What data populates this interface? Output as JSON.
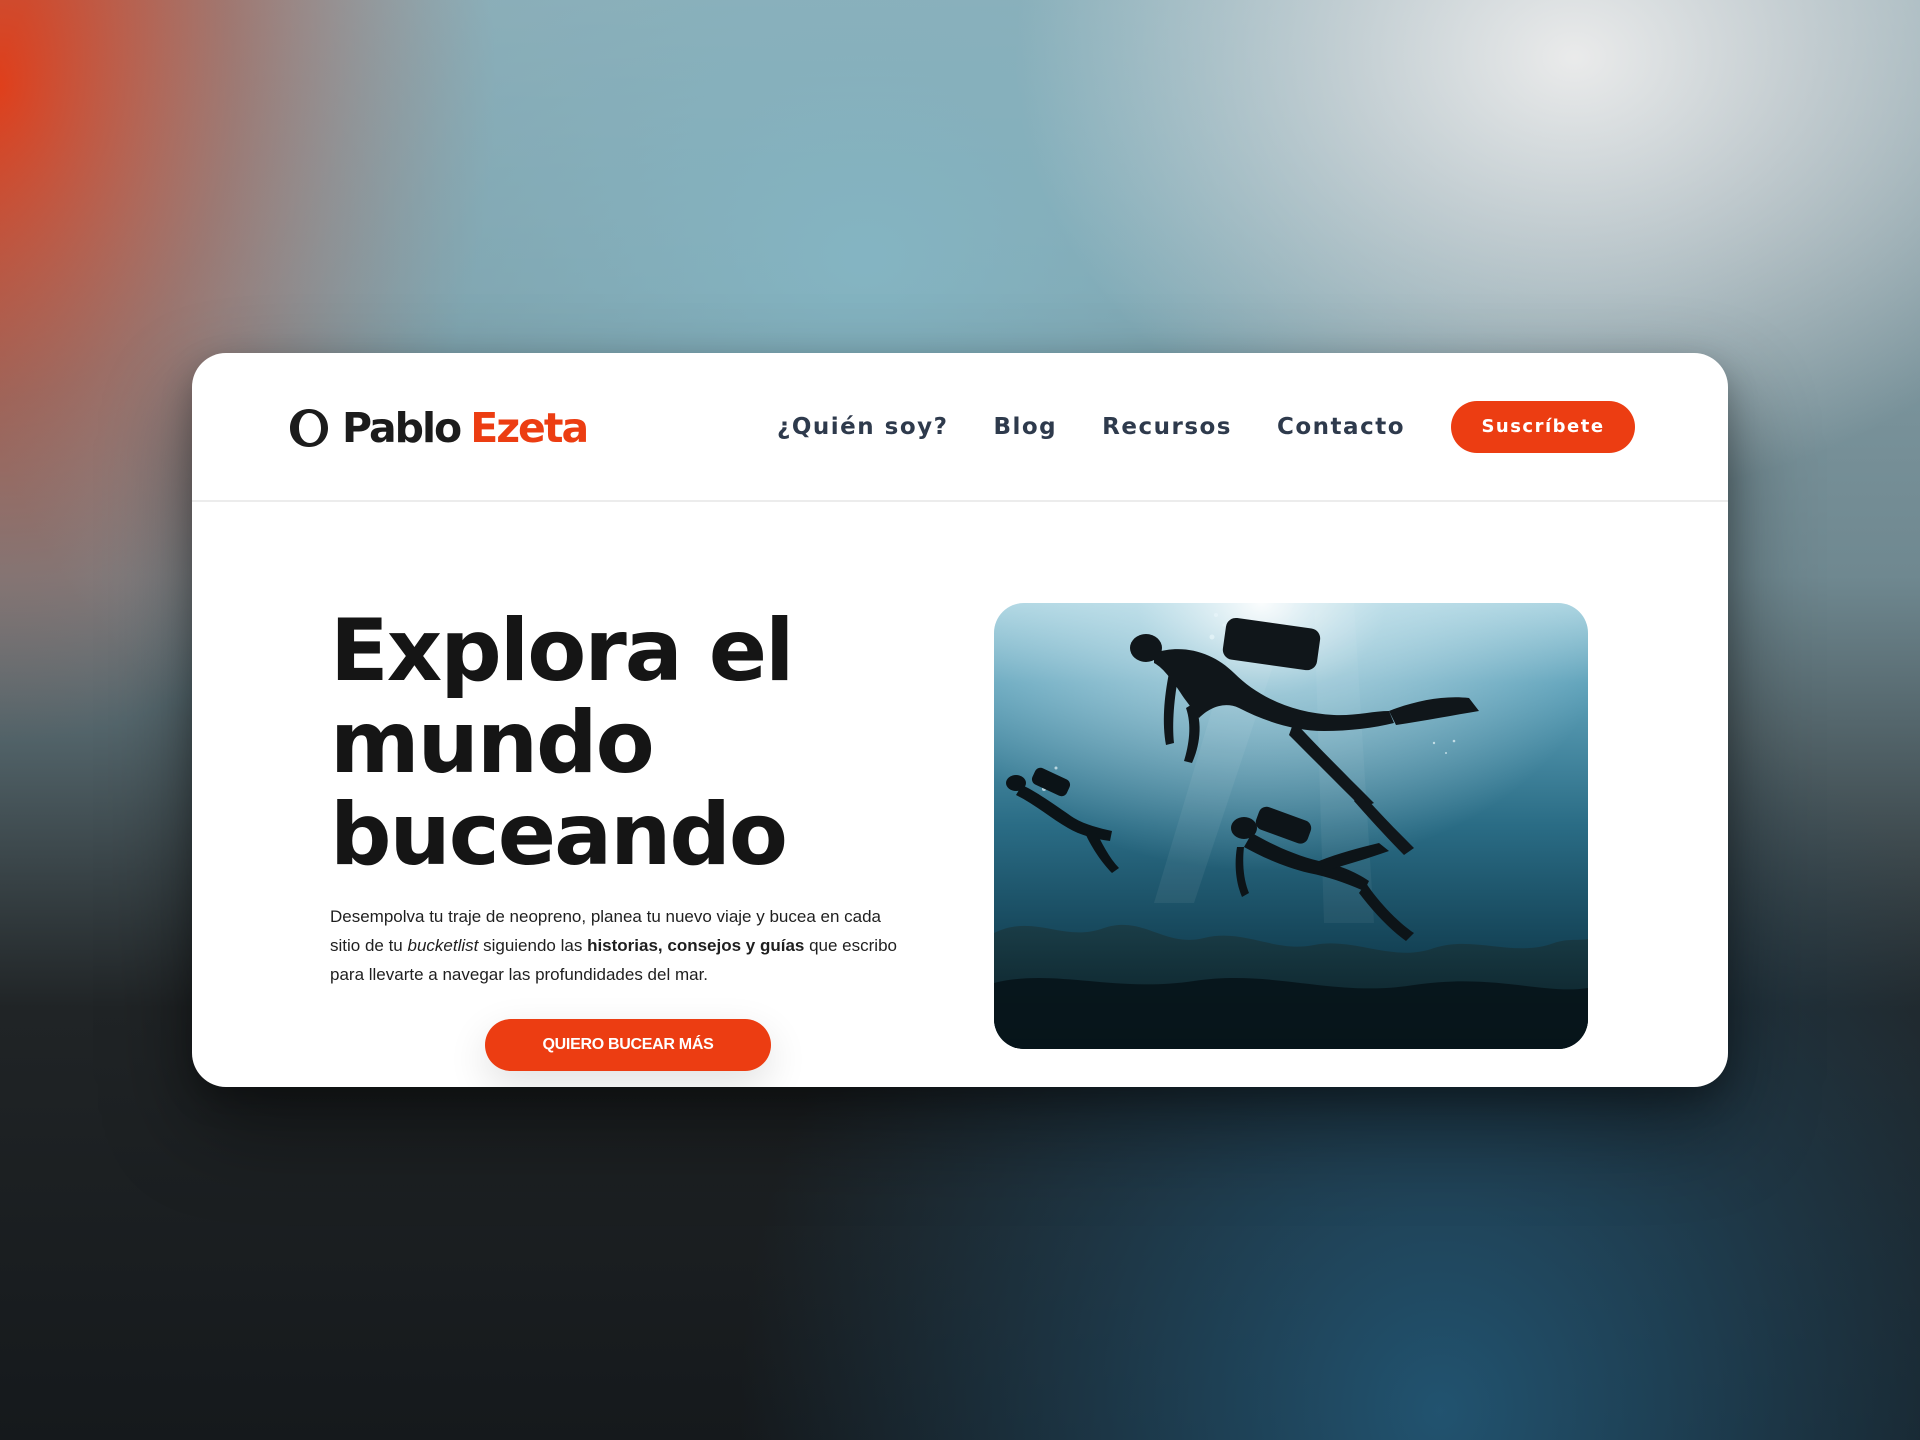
{
  "site": {
    "logo_first": "Pablo",
    "logo_last": "Ezeta",
    "logo_icon": "ring-logo-icon"
  },
  "nav": {
    "items": [
      {
        "label": "¿Quién soy?"
      },
      {
        "label": "Blog"
      },
      {
        "label": "Recursos"
      },
      {
        "label": "Contacto"
      }
    ],
    "subscribe_label": "Suscríbete"
  },
  "hero": {
    "title_line_1": "Explora el",
    "title_line_2": "mundo",
    "title_line_3": "buceando",
    "desc_part_1": "Desempolva tu traje de neopreno, planea tu nuevo viaje y bucea en cada sitio de tu ",
    "desc_italic": "bucketlist",
    "desc_part_2": " siguiendo las ",
    "desc_bold": "historias, consejos y guías",
    "desc_part_3": " que escribo para llevarte a navegar las profundidades del mar.",
    "cta_label": "QUIERO BUCEAR MÁS",
    "image_subject": "scuba-divers-underwater-photo"
  },
  "colors": {
    "accent": "#ec3d12",
    "text_dark": "#151515",
    "nav_text": "#2e3a4c",
    "card_bg": "#ffffff"
  }
}
